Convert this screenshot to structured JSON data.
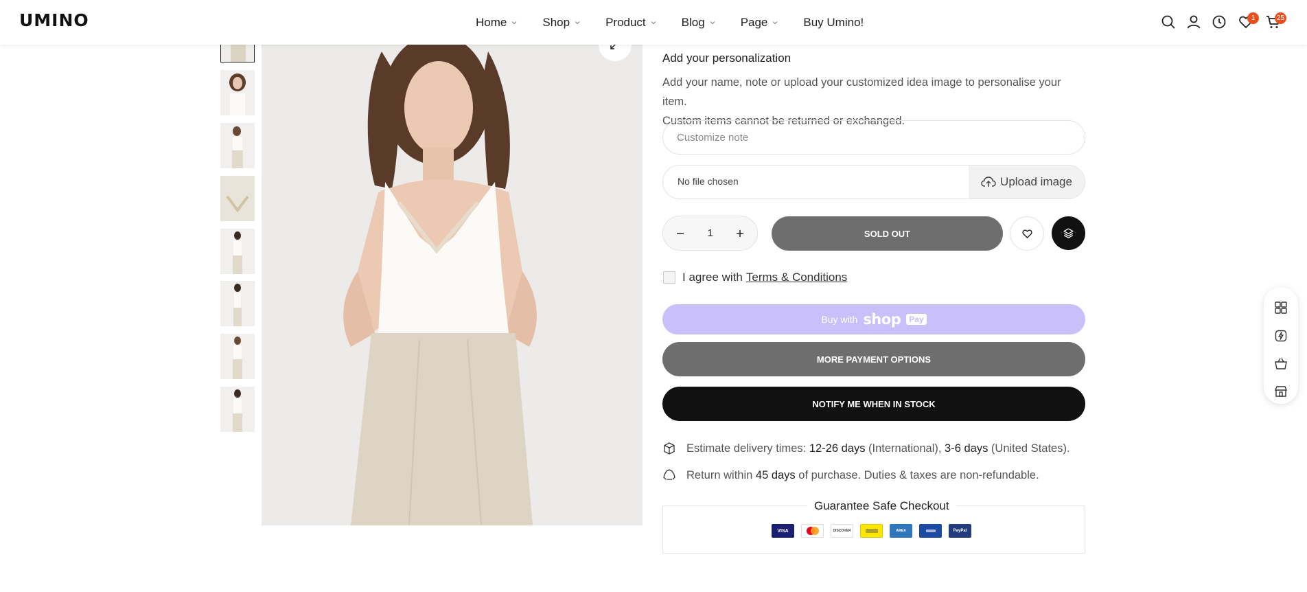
{
  "header": {
    "logo": "UMINO",
    "nav": [
      {
        "label": "Home",
        "has_dropdown": true
      },
      {
        "label": "Shop",
        "has_dropdown": true
      },
      {
        "label": "Product",
        "has_dropdown": true
      },
      {
        "label": "Blog",
        "has_dropdown": true
      },
      {
        "label": "Page",
        "has_dropdown": true
      },
      {
        "label": "Buy Umino!",
        "has_dropdown": false
      }
    ],
    "icons": [
      "search-icon",
      "account-icon",
      "recently-viewed-icon",
      "wishlist-icon",
      "cart-icon"
    ],
    "wishlist_count": "1",
    "cart_count": "25"
  },
  "personalization": {
    "heading": "Add your personalization",
    "desc_line1": "Add your name, note or upload your customized idea image to personalise your item.",
    "desc_line2": "Custom items cannot be returned or exchanged.",
    "note_placeholder": "Customize note",
    "file_status": "No file chosen",
    "upload_label": "Upload image"
  },
  "purchase": {
    "quantity": "1",
    "sold_out_label": "SOLD OUT",
    "agree_text": "I agree with",
    "terms_link": "Terms & Conditions",
    "shoppay_prefix": "Buy with",
    "shoppay_brand": "shop",
    "shoppay_pay": "Pay",
    "more_payment_label": "MORE PAYMENT OPTIONS",
    "notify_label": "NOTIFY ME WHEN IN STOCK"
  },
  "delivery": {
    "prefix": "Estimate delivery times:",
    "intl_days": "12-26 days",
    "intl_label": "(International),",
    "us_days": "3-6 days",
    "us_label": "(United States)."
  },
  "returns": {
    "prefix": "Return within",
    "days": "45 days",
    "suffix": "of purchase. Duties & taxes are non-refundable."
  },
  "guarantee": {
    "title": "Guarantee Safe Checkout",
    "cards": [
      "VISA",
      "MC",
      "DISCOVER",
      "",
      "AMEX",
      "",
      "PayPal"
    ]
  },
  "colors": {
    "accent_badge": "#e8501f",
    "shoppay": "#c9c0fa",
    "sold_out": "#6e6e6e",
    "notify": "#111111"
  }
}
